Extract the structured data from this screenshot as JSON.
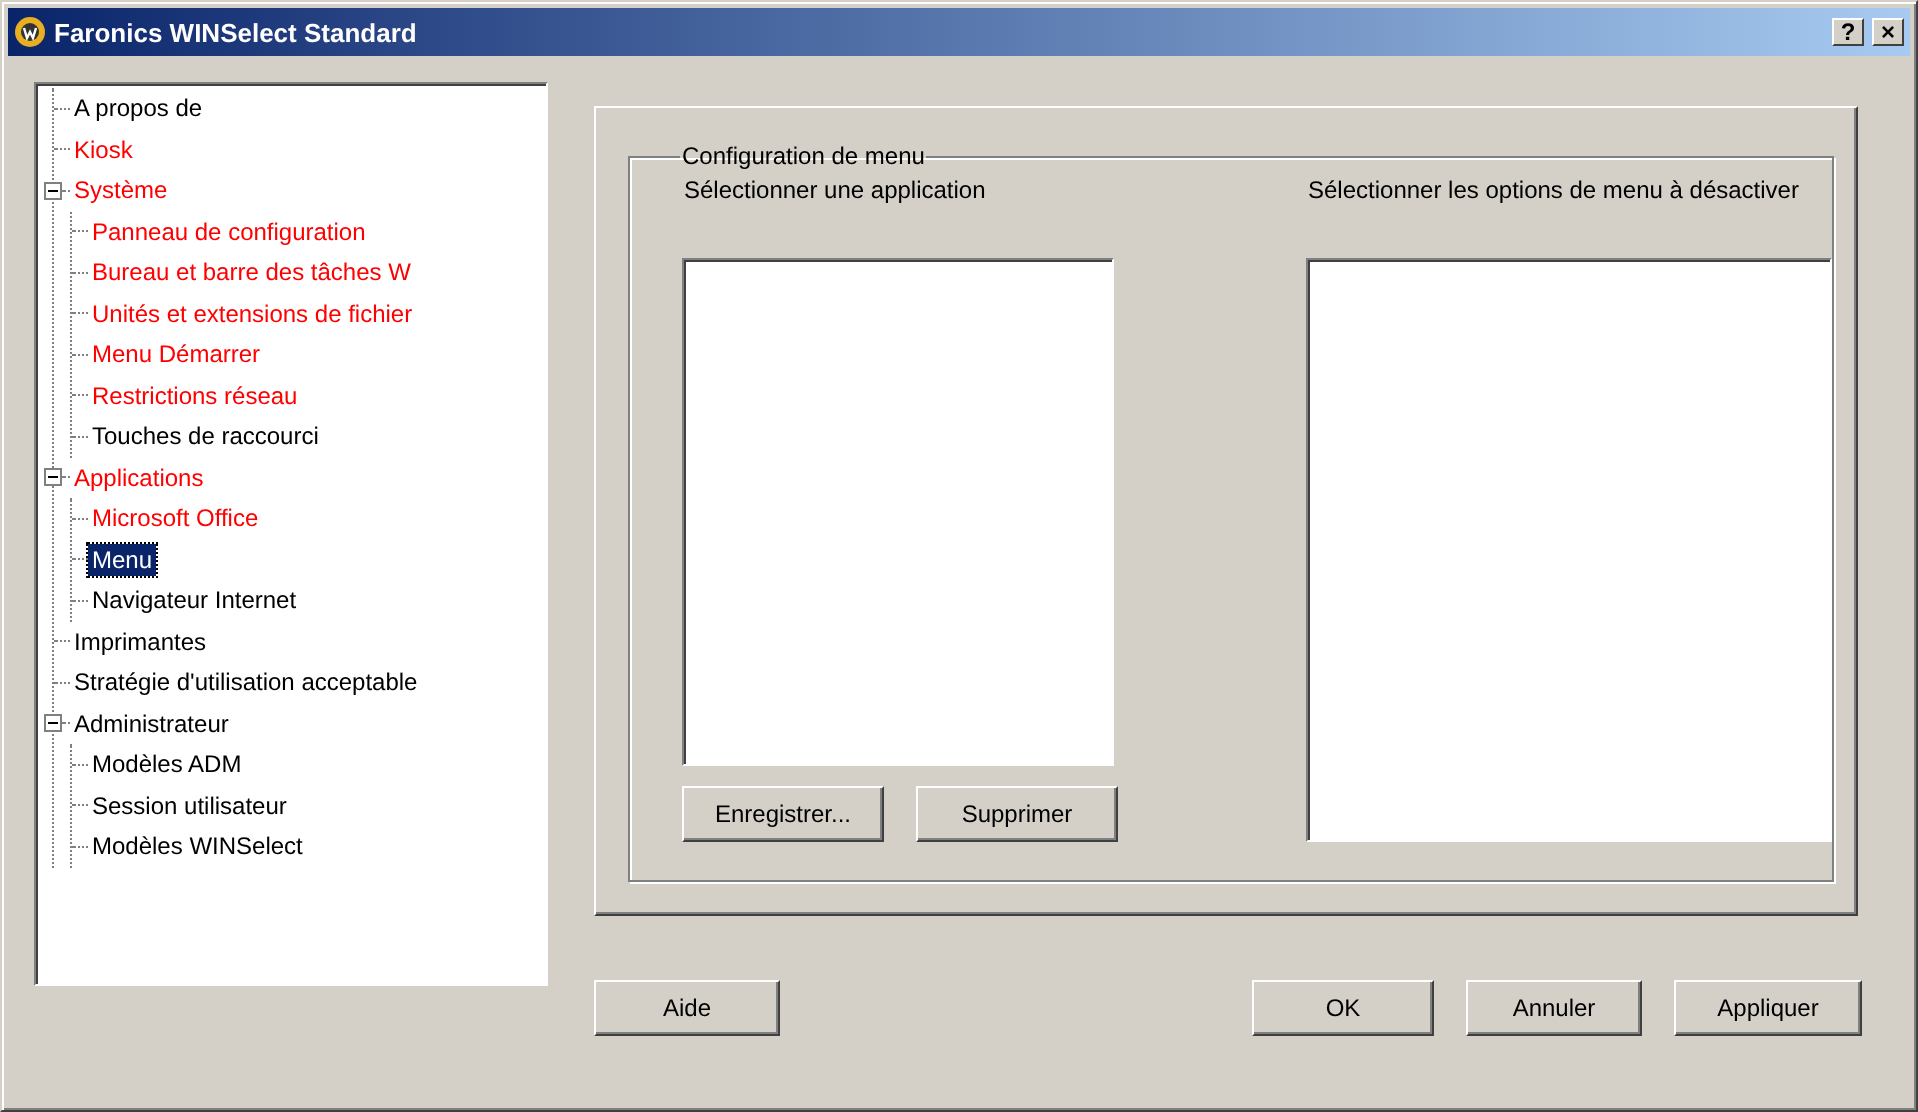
{
  "window": {
    "title": "Faronics WINSelect Standard",
    "title_buttons": [
      "?",
      "×"
    ]
  },
  "tree": [
    {
      "label": "A propos de",
      "configured": false,
      "selected": false
    },
    {
      "label": "Kiosk",
      "configured": true,
      "selected": false
    },
    {
      "label": "Système",
      "configured": true,
      "selected": false,
      "expanded": true,
      "children": [
        {
          "label": "Panneau de configuration",
          "configured": true,
          "selected": false
        },
        {
          "label": "Bureau et barre des tâches W",
          "configured": true,
          "selected": false
        },
        {
          "label": "Unités et extensions de fichier",
          "configured": true,
          "selected": false
        },
        {
          "label": "Menu Démarrer",
          "configured": true,
          "selected": false
        },
        {
          "label": "Restrictions réseau",
          "configured": true,
          "selected": false
        },
        {
          "label": "Touches de raccourci",
          "configured": false,
          "selected": false
        }
      ]
    },
    {
      "label": "Applications",
      "configured": true,
      "selected": false,
      "expanded": true,
      "children": [
        {
          "label": "Microsoft Office",
          "configured": true,
          "selected": false
        },
        {
          "label": "Menu",
          "configured": false,
          "selected": true
        },
        {
          "label": "Navigateur Internet",
          "configured": false,
          "selected": false
        }
      ]
    },
    {
      "label": "Imprimantes",
      "configured": false,
      "selected": false
    },
    {
      "label": "Stratégie d'utilisation acceptable",
      "configured": false,
      "selected": false
    },
    {
      "label": "Administrateur",
      "configured": false,
      "selected": false,
      "expanded": true,
      "children": [
        {
          "label": "Modèles ADM",
          "configured": false,
          "selected": false
        },
        {
          "label": "Session utilisateur",
          "configured": false,
          "selected": false
        },
        {
          "label": "Modèles WINSelect",
          "configured": false,
          "selected": false
        }
      ]
    }
  ],
  "group": {
    "title": "Configuration de menu",
    "app_label": "Sélectionner une application",
    "options_label": "Sélectionner les options de menu à désactiver",
    "app_buttons": [
      "Enregistrer...",
      "Supprimer"
    ]
  },
  "buttons": {
    "help": "Aide",
    "actions": [
      "OK",
      "Annuler",
      "Appliquer"
    ]
  }
}
